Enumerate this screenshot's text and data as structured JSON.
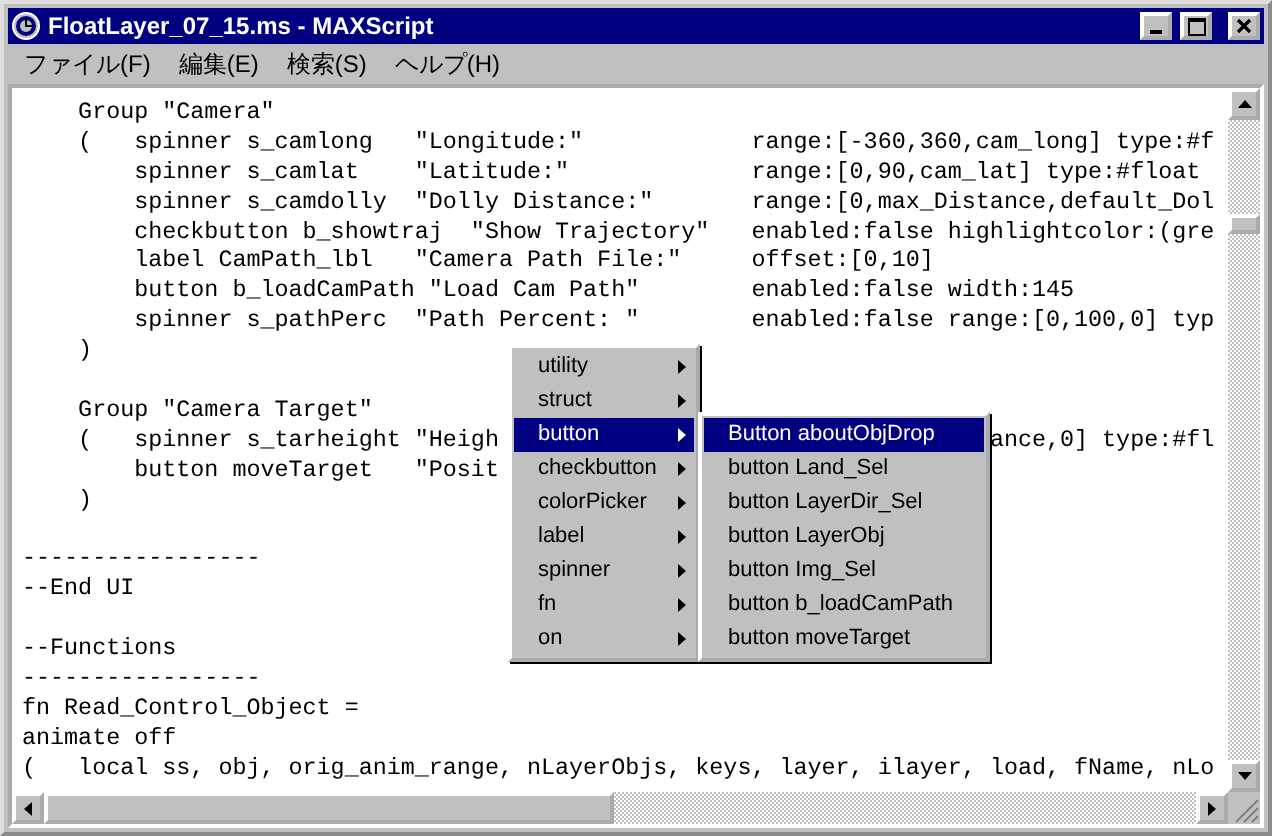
{
  "window": {
    "title": "FloatLayer_07_15.ms - MAXScript"
  },
  "menu_bar": [
    {
      "label": "ファイル(F)"
    },
    {
      "label": "編集(E)"
    },
    {
      "label": "検索(S)"
    },
    {
      "label": "ヘルプ(H)"
    }
  ],
  "editor": {
    "lines": [
      {
        "kind": "code",
        "text": "    Group \"Camera\""
      },
      {
        "kind": "columns",
        "text": "    (   spinner s_camlong   \"Longitude:\"",
        "tail": "range:[-360,360,cam_long] type:#f"
      },
      {
        "kind": "columns",
        "text": "        spinner s_camlat    \"Latitude:\"",
        "tail": "range:[0,90,cam_lat] type:#float"
      },
      {
        "kind": "columns",
        "text": "        spinner s_camdolly  \"Dolly Distance:\"",
        "tail": "range:[0,max_Distance,default_Dol"
      },
      {
        "kind": "columns",
        "text": "        checkbutton b_showtraj  \"Show Trajectory\"",
        "tail": "enabled:false highlightcolor:(gre"
      },
      {
        "kind": "columns",
        "text": "        label CamPath_lbl   \"Camera Path File:\"",
        "tail": "offset:[0,10]"
      },
      {
        "kind": "columns",
        "text": "        button b_loadCamPath \"Load Cam Path\"",
        "tail": "enabled:false width:145"
      },
      {
        "kind": "columns",
        "text": "        spinner s_pathPerc  \"Path Percent: \"",
        "tail": "enabled:false range:[0,100,0] typ"
      },
      {
        "kind": "code",
        "text": "    )"
      },
      {
        "kind": "blank"
      },
      {
        "kind": "code",
        "text": "    Group \"Camera Target\""
      },
      {
        "kind": "occluded",
        "text": "    (   spinner s_tarheight \"Heigh",
        "tail": "ance,0] type:#fl"
      },
      {
        "kind": "code",
        "text": "        button moveTarget   \"Posit"
      },
      {
        "kind": "code",
        "text": "    )"
      },
      {
        "kind": "blank"
      },
      {
        "kind": "code",
        "text": "-----------------"
      },
      {
        "kind": "code",
        "text": "--End UI"
      },
      {
        "kind": "blank"
      },
      {
        "kind": "code",
        "text": "--Functions"
      },
      {
        "kind": "code",
        "text": "-----------------"
      },
      {
        "kind": "code",
        "text": "fn Read_Control_Object ="
      },
      {
        "kind": "code",
        "text": "animate off"
      },
      {
        "kind": "code",
        "text": "(   local ss, obj, orig_anim_range, nLayerObjs, keys, layer, ilayer, load, fName, nLo"
      }
    ]
  },
  "context_menu": {
    "items": [
      {
        "label": "utility",
        "selected": false,
        "has_submenu": true
      },
      {
        "label": "struct",
        "selected": false,
        "has_submenu": true
      },
      {
        "label": "button",
        "selected": true,
        "has_submenu": true
      },
      {
        "label": "checkbutton",
        "selected": false,
        "has_submenu": true
      },
      {
        "label": "colorPicker",
        "selected": false,
        "has_submenu": true
      },
      {
        "label": "label",
        "selected": false,
        "has_submenu": true
      },
      {
        "label": "spinner",
        "selected": false,
        "has_submenu": true
      },
      {
        "label": "fn",
        "selected": false,
        "has_submenu": true
      },
      {
        "label": "on",
        "selected": false,
        "has_submenu": true
      }
    ],
    "submenu": {
      "items": [
        {
          "label": "Button aboutObjDrop",
          "selected": true
        },
        {
          "label": "button Land_Sel",
          "selected": false
        },
        {
          "label": "button LayerDir_Sel",
          "selected": false
        },
        {
          "label": "button LayerObj",
          "selected": false
        },
        {
          "label": "button Img_Sel",
          "selected": false
        },
        {
          "label": "button b_loadCamPath",
          "selected": false
        },
        {
          "label": "button moveTarget",
          "selected": false
        }
      ]
    }
  }
}
